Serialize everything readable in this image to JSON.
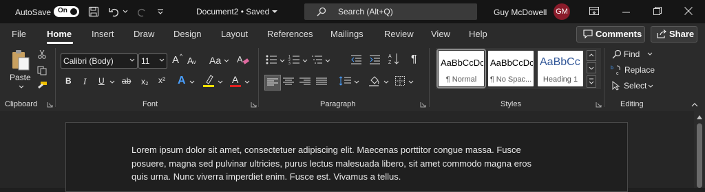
{
  "titlebar": {
    "autosave_label": "AutoSave",
    "autosave_state": "On",
    "document_title": "Document2 • Saved",
    "search_placeholder": "Search (Alt+Q)",
    "user_name": "Guy McDowell",
    "user_initials": "GM"
  },
  "tabs": [
    "File",
    "Home",
    "Insert",
    "Draw",
    "Design",
    "Layout",
    "References",
    "Mailings",
    "Review",
    "View",
    "Help"
  ],
  "active_tab": "Home",
  "buttons": {
    "comments": "Comments",
    "share": "Share"
  },
  "ribbon": {
    "clipboard": {
      "paste_label": "Paste",
      "group_label": "Clipboard"
    },
    "font": {
      "font_name": "Calibri (Body)",
      "font_size": "11",
      "group_label": "Font",
      "grow": "A",
      "change_case": "Aa",
      "bold": "B",
      "italic": "I",
      "underline": "U",
      "strike": "ab",
      "subscript": "x₂",
      "superscript": "x²",
      "effects": "A",
      "highlight": "ab",
      "font_color": "A"
    },
    "paragraph": {
      "group_label": "Paragraph"
    },
    "styles": {
      "group_label": "Styles",
      "items": [
        {
          "sample": "AaBbCcDc",
          "name": "¶ Normal"
        },
        {
          "sample": "AaBbCcDc",
          "name": "¶ No Spac..."
        },
        {
          "sample": "AaBbCc",
          "name": "Heading 1"
        }
      ]
    },
    "editing": {
      "find": "Find",
      "replace": "Replace",
      "select": "Select",
      "group_label": "Editing"
    }
  },
  "document": {
    "lines": [
      "Lorem ipsum dolor sit amet, consectetuer adipiscing elit. Maecenas porttitor congue massa. Fusce",
      "posuere, magna sed pulvinar ultricies, purus lectus malesuada libero, sit amet commodo magna eros",
      "quis urna. Nunc viverra imperdiet enim. Fusce est. Vivamus a tellus."
    ]
  },
  "colors": {
    "highlight": "#f0e000",
    "font_color": "#e02020",
    "avatar": "#8a1c2b",
    "heading_blue": "#2f5597"
  }
}
